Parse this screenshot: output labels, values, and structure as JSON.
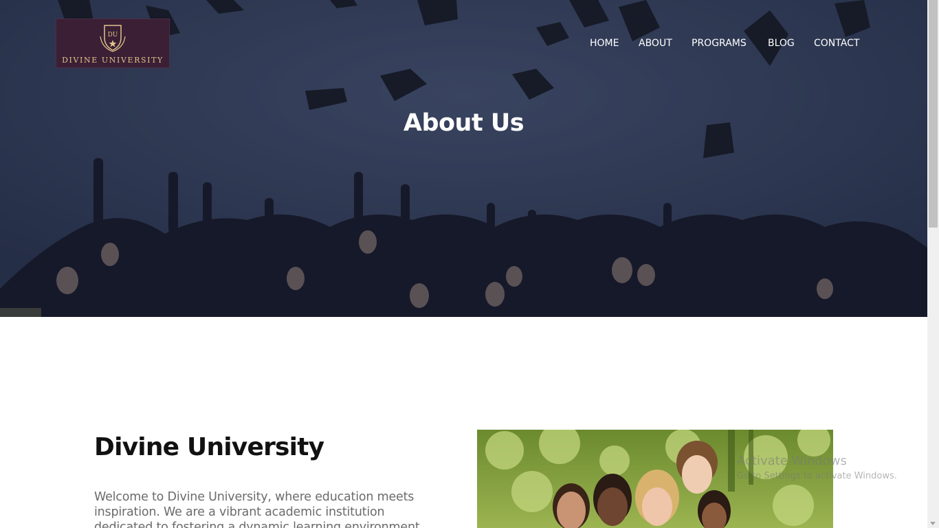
{
  "brand": {
    "name": "DIVINE UNIVERSITY",
    "monogram": "DU",
    "colors": {
      "logo_bg": "#3a1f35",
      "logo_gold": "#e2c48c"
    }
  },
  "nav": {
    "items": [
      {
        "label": "HOME"
      },
      {
        "label": "ABOUT"
      },
      {
        "label": "PROGRAMS"
      },
      {
        "label": "BLOG"
      },
      {
        "label": "CONTACT"
      }
    ]
  },
  "hero": {
    "title": "About Us",
    "image": "graduates-throwing-caps"
  },
  "about": {
    "heading": "Divine University",
    "body": "Welcome to Divine University, where education meets inspiration. We are a vibrant academic institution dedicated to fostering a dynamic learning environment that empowers students to excel academically and",
    "image": "smiling-students-group"
  },
  "watermark": {
    "title": "Activate Windows",
    "subtitle": "Go to Settings to activate Windows."
  }
}
